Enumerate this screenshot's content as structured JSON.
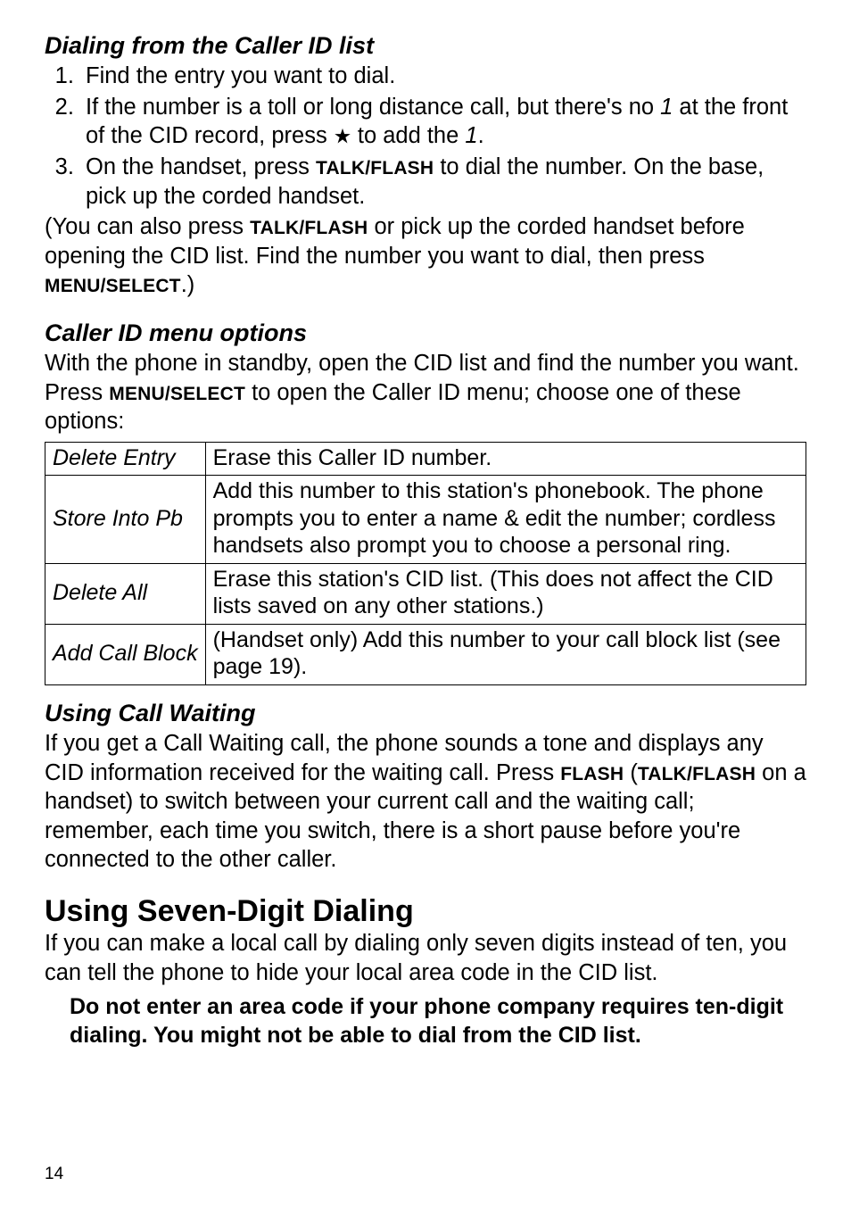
{
  "page_number": "14",
  "sections": {
    "dialing": {
      "heading": "Dialing from the Caller ID list",
      "step1": "Find the entry you want to dial.",
      "step2_pre": "If the number is a toll or long distance call, but there's no ",
      "step2_italic1": "1",
      "step2_mid": " at the front of the CID record, press ",
      "step2_after_star": " to add the ",
      "step2_italic2": "1",
      "step2_end": ".",
      "step3_pre": "On the handset, press ",
      "step3_key": "TALK/FLASH",
      "step3_post": " to dial the number. On the base, pick up the corded handset.",
      "note_pre": "(You can also press ",
      "note_key1": "TALK/FLASH",
      "note_mid": " or pick up the corded handset before opening the CID list. Find the number you want to dial, then press ",
      "note_key2": "MENU/SELECT",
      "note_end": ".)"
    },
    "cidmenu": {
      "heading": "Caller ID menu options",
      "intro_pre": "With the phone in standby, open the CID list and find the number you want. Press ",
      "intro_key": "MENU/SELECT",
      "intro_post": " to open the Caller ID menu; choose one of these options:",
      "rows": {
        "r1_label": "Delete Entry",
        "r1_desc": "Erase this Caller ID number.",
        "r2_label": "Store Into Pb",
        "r2_desc": "Add this number to this station's phonebook. The phone prompts you to enter a name & edit the number; cordless handsets also prompt you to choose a personal ring.",
        "r3_label": "Delete All",
        "r3_desc": "Erase this station's CID list. (This does not affect the CID lists saved on any other stations.)",
        "r4_label": "Add Call Block",
        "r4_desc": "(Handset only) Add this number to your call block list (see page 19)."
      }
    },
    "callwaiting": {
      "heading": "Using Call Waiting",
      "body_pre": "If you get a Call Waiting call, the phone sounds a tone and displays any CID information received for the waiting call. Press ",
      "key1": "FLASH",
      "paren_open": " (",
      "key2": "TALK/FLASH",
      "body_post": " on a handset) to switch between your current call and the waiting call; remember, each time you switch, there is a short pause before you're connected to the other caller."
    },
    "sevendigit": {
      "heading": "Using Seven-Digit Dialing",
      "body": "If you can make a local call by dialing only seven digits instead of ten, you can tell the phone to hide your local area code in the CID list.",
      "warning": "Do not enter an area code if your phone company requires ten-digit dialing. You might not be able to dial from the CID list."
    }
  },
  "icons": {
    "star": "star-icon"
  }
}
